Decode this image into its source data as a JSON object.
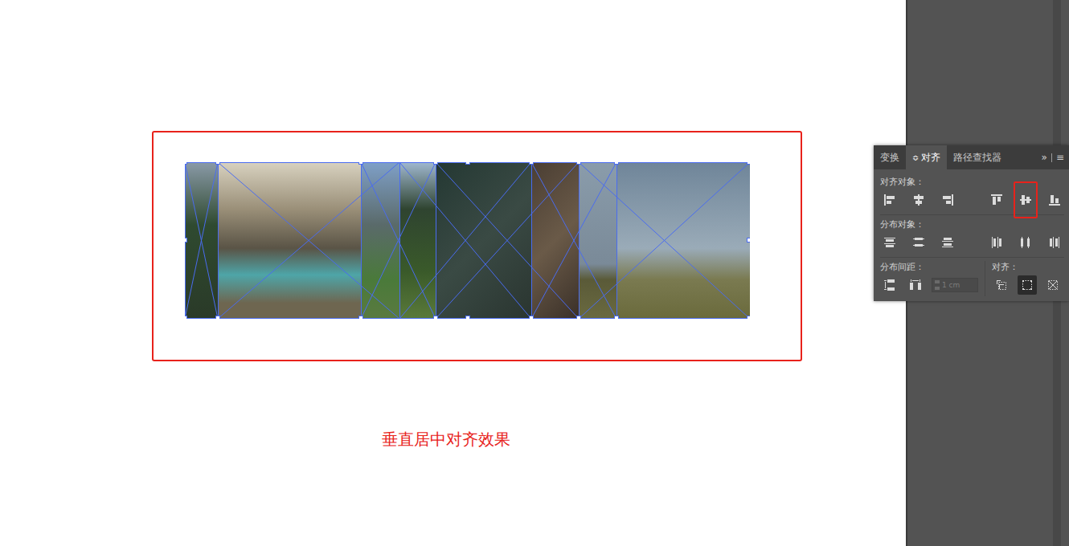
{
  "canvas": {
    "caption": "垂直居中对齐效果",
    "photo_group": {
      "selected": true
    }
  },
  "panel": {
    "tabs": [
      {
        "label": "变换",
        "selected": false,
        "prefix": ""
      },
      {
        "label": "对齐",
        "selected": true,
        "prefix": "≎"
      },
      {
        "label": "路径查找器",
        "selected": false,
        "prefix": ""
      }
    ],
    "overflow": "»",
    "menu": "≡",
    "align_objects": {
      "label": "对齐对象：",
      "buttons": [
        {
          "kind": "align-left",
          "highlighted": false
        },
        {
          "kind": "align-hcenter",
          "highlighted": false
        },
        {
          "kind": "align-right",
          "highlighted": false
        },
        {
          "kind": "align-top",
          "highlighted": false
        },
        {
          "kind": "align-vcenter",
          "highlighted": true
        },
        {
          "kind": "align-bottom",
          "highlighted": false
        }
      ]
    },
    "distribute_objects": {
      "label": "分布对象：",
      "buttons": [
        {
          "kind": "dist-top"
        },
        {
          "kind": "dist-vcenter"
        },
        {
          "kind": "dist-bottom"
        },
        {
          "kind": "dist-left"
        },
        {
          "kind": "dist-hcenter"
        },
        {
          "kind": "dist-right"
        }
      ]
    },
    "distribute_spacing": {
      "label": "分布间距：",
      "buttons": [
        {
          "kind": "space-v"
        },
        {
          "kind": "space-h"
        }
      ],
      "field": {
        "value": "1 cm",
        "disabled": true
      }
    },
    "align_to": {
      "label": "对齐：",
      "buttons": [
        {
          "kind": "artboard",
          "selected": false
        },
        {
          "kind": "selection",
          "selected": true
        },
        {
          "kind": "key-object",
          "selected": false
        }
      ]
    }
  }
}
